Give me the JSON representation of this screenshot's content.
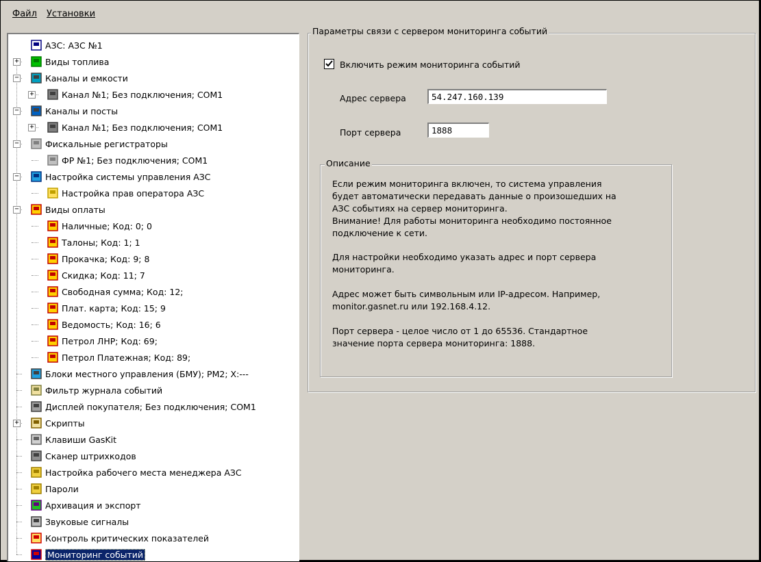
{
  "menu": {
    "file": "Файл",
    "settings": "Установки"
  },
  "tree": [
    {
      "label": "АЗС: АЗС №1",
      "icon": "station-icon",
      "level": 0,
      "expander": null
    },
    {
      "label": "Виды топлива",
      "icon": "fuel-icon",
      "level": 0,
      "expander": "+"
    },
    {
      "label": "Каналы и емкости",
      "icon": "channel-tank-icon",
      "level": 0,
      "expander": "-"
    },
    {
      "label": "Канал №1; Без подключения; COM1",
      "icon": "connector-icon",
      "level": 1,
      "expander": "+"
    },
    {
      "label": "Каналы и посты",
      "icon": "channel-post-icon",
      "level": 0,
      "expander": "-"
    },
    {
      "label": "Канал №1; Без подключения; COM1",
      "icon": "connector-icon",
      "level": 1,
      "expander": "+"
    },
    {
      "label": "Фискальные регистраторы",
      "icon": "fiscal-register-icon",
      "level": 0,
      "expander": "-"
    },
    {
      "label": "ФР №1; Без подключения; COM1",
      "icon": "fiscal-register-icon",
      "level": 1,
      "expander": null
    },
    {
      "label": "Настройка системы управления АЗС",
      "icon": "control-panel-icon",
      "level": 0,
      "expander": "-"
    },
    {
      "label": "Настройка прав оператора АЗС",
      "icon": "key-icon",
      "level": 1,
      "expander": null
    },
    {
      "label": "Виды оплаты",
      "icon": "payment-icon",
      "level": 0,
      "expander": "-"
    },
    {
      "label": "Наличные; Код: 0; 0",
      "icon": "payment-icon",
      "level": 1,
      "expander": null
    },
    {
      "label": "Талоны; Код: 1; 1",
      "icon": "payment-icon",
      "level": 1,
      "expander": null
    },
    {
      "label": "Прокачка; Код: 9; 8",
      "icon": "payment-icon",
      "level": 1,
      "expander": null
    },
    {
      "label": "Скидка; Код: 11; 7",
      "icon": "payment-icon",
      "level": 1,
      "expander": null
    },
    {
      "label": "Свободная сумма; Код: 12;",
      "icon": "payment-icon",
      "level": 1,
      "expander": null
    },
    {
      "label": "Плат. карта; Код: 15; 9",
      "icon": "payment-icon",
      "level": 1,
      "expander": null
    },
    {
      "label": "Ведомость; Код: 16; 6",
      "icon": "payment-icon",
      "level": 1,
      "expander": null
    },
    {
      "label": "Петрол ЛНР; Код: 69;",
      "icon": "payment-icon",
      "level": 1,
      "expander": null
    },
    {
      "label": "Петрол Платежная; Код: 89;",
      "icon": "payment-icon",
      "level": 1,
      "expander": null
    },
    {
      "label": "Блоки местного управления (БМУ);  PM2;  X:---",
      "icon": "local-control-icon",
      "level": 0,
      "expander": null
    },
    {
      "label": "Фильтр журнала событий",
      "icon": "filter-icon",
      "level": 0,
      "expander": null
    },
    {
      "label": "Дисплей покупателя; Без подключения; COM1",
      "icon": "display-icon",
      "level": 0,
      "expander": null
    },
    {
      "label": "Скрипты",
      "icon": "script-icon",
      "level": 0,
      "expander": "+"
    },
    {
      "label": "Клавиши GasKit",
      "icon": "keyboard-icon",
      "level": 0,
      "expander": null
    },
    {
      "label": "Сканер штрихкодов",
      "icon": "barcode-scanner-icon",
      "level": 0,
      "expander": null
    },
    {
      "label": "Настройка рабочего места менеджера АЗС",
      "icon": "briefcase-icon",
      "level": 0,
      "expander": null
    },
    {
      "label": "Пароли",
      "icon": "lock-icon",
      "level": 0,
      "expander": null
    },
    {
      "label": "Архивация и экспорт",
      "icon": "archive-icon",
      "level": 0,
      "expander": null
    },
    {
      "label": "Звуковые сигналы",
      "icon": "speaker-icon",
      "level": 0,
      "expander": null
    },
    {
      "label": "Контроль критических показателей",
      "icon": "alert-mail-icon",
      "level": 0,
      "expander": null
    },
    {
      "label": "Мониторинг событий",
      "icon": "monitoring-icon",
      "level": 0,
      "expander": null,
      "selected": true
    }
  ],
  "panel": {
    "group_title": "Параметры связи с сервером мониторинга событий",
    "enable_label": "Включить режим мониторинга событий",
    "enable_checked": true,
    "address_label": "Адрес сервера",
    "address_value": "54.247.160.139",
    "port_label": "Порт сервера",
    "port_value": "1888",
    "desc_title": "Описание",
    "desc_lines": [
      "Если режим мониторинга включен, то система управления",
      "будет автоматически передавать данные о произошедших на",
      "АЗС событиях на сервер мониторинга.",
      "Внимание! Для работы мониторинга необходимо постоянное",
      "подключение к сети.",
      "",
      "Для настройки необходимо указать адрес и порт сервера",
      "мониторинга.",
      "",
      "Адрес может быть символьным или IP-адресом. Например,",
      "monitor.gasnet.ru или 192.168.4.12.",
      "",
      "Порт сервера - целое число от 1 до 65536. Стандартное",
      "значение порта сервера мониторинга: 1888."
    ]
  }
}
